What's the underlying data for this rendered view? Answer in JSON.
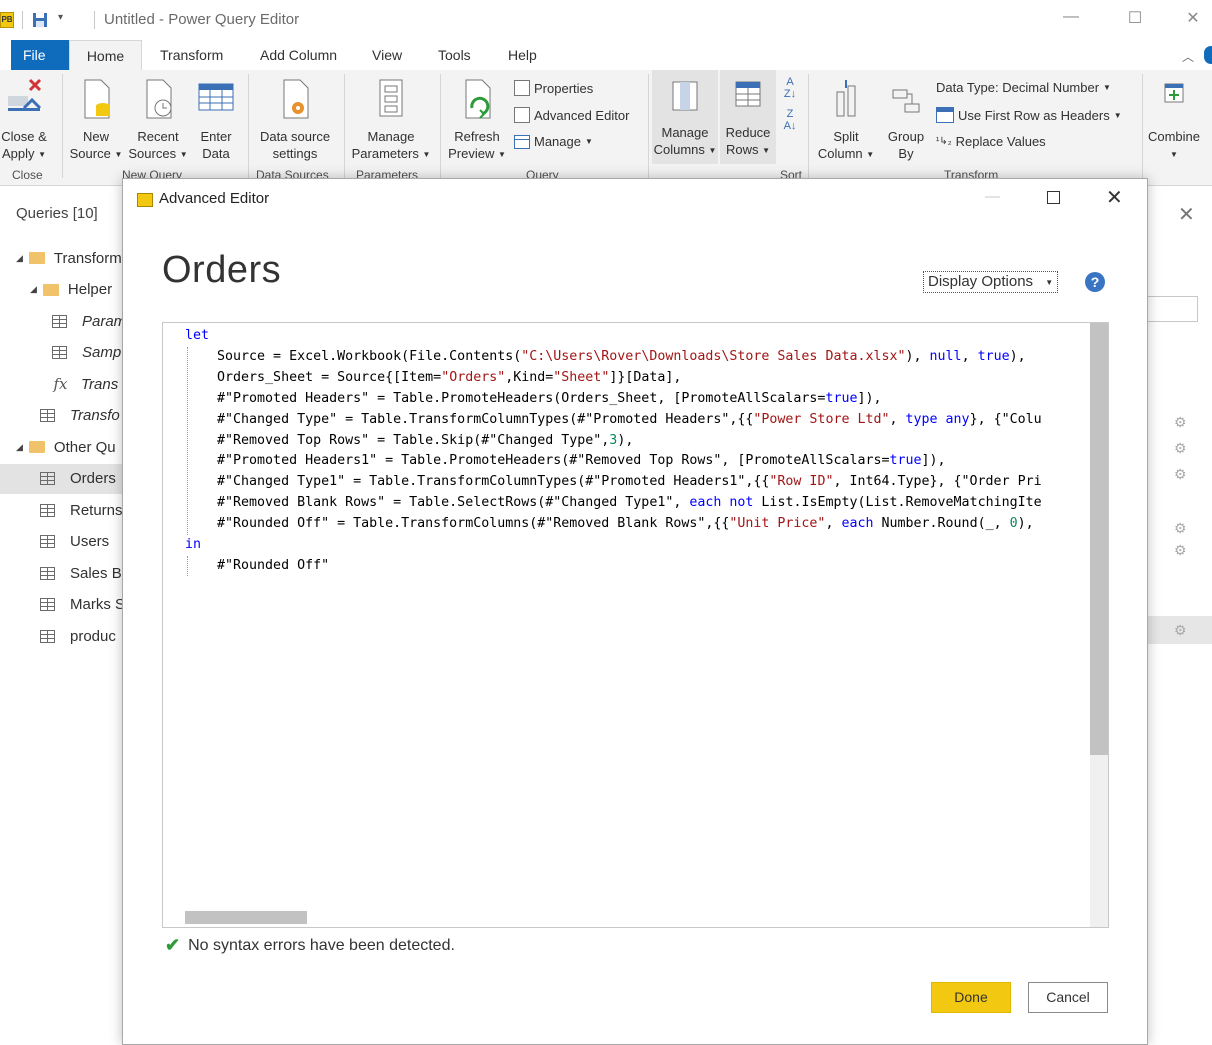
{
  "window": {
    "title": "Untitled - Power Query Editor",
    "app_icon_glyph": "PB",
    "quick_access_dropdown": "▾"
  },
  "tabs": [
    "File",
    "Home",
    "Transform",
    "Add Column",
    "View",
    "Tools",
    "Help"
  ],
  "ribbon": {
    "close_apply": [
      "Close &",
      "Apply"
    ],
    "new_source": [
      "New",
      "Source"
    ],
    "recent_sources": [
      "Recent",
      "Sources"
    ],
    "enter_data": [
      "Enter",
      "Data"
    ],
    "data_source_settings": [
      "Data source",
      "settings"
    ],
    "manage_parameters": [
      "Manage",
      "Parameters"
    ],
    "refresh_preview": [
      "Refresh",
      "Preview"
    ],
    "properties": "Properties",
    "advanced_editor": "Advanced Editor",
    "manage": "Manage",
    "manage_columns": [
      "Manage",
      "Columns"
    ],
    "reduce_rows": [
      "Reduce",
      "Rows"
    ],
    "split_column": [
      "Split",
      "Column"
    ],
    "group_by": [
      "Group",
      "By"
    ],
    "data_type": "Data Type: Decimal Number",
    "use_first_row": "Use First Row as Headers",
    "replace_values": "Replace Values",
    "combine": "Combine",
    "groups": {
      "close": "Close",
      "new_query": "New Query",
      "data_sources": "Data Sources",
      "parameters": "Parameters",
      "query": "Query",
      "sort": "Sort",
      "transform": "Transform"
    }
  },
  "queries": {
    "title": "Queries [10]",
    "items": [
      {
        "label": "Transform",
        "kind": "folder",
        "level": 0
      },
      {
        "label": "Helper",
        "kind": "folder",
        "level": 1
      },
      {
        "label": "Param",
        "kind": "param",
        "level": 2
      },
      {
        "label": "Samp",
        "kind": "sample",
        "level": 2
      },
      {
        "label": "Trans",
        "kind": "function",
        "level": 2
      },
      {
        "label": "Transfo",
        "kind": "table",
        "level": 1
      },
      {
        "label": "Other Qu",
        "kind": "folder",
        "level": 0
      },
      {
        "label": "Orders",
        "kind": "table",
        "level": 1,
        "selected": true
      },
      {
        "label": "Returns",
        "kind": "table",
        "level": 1
      },
      {
        "label": "Users",
        "kind": "table",
        "level": 1
      },
      {
        "label": "Sales B",
        "kind": "table",
        "level": 1
      },
      {
        "label": "Marks S",
        "kind": "table",
        "level": 1
      },
      {
        "label": "produc",
        "kind": "table",
        "level": 1
      }
    ]
  },
  "dialog": {
    "title": "Advanced Editor",
    "query_name": "Orders",
    "display_options": "Display Options",
    "help": "?",
    "syntax_status": "No syntax errors have been detected.",
    "done": "Done",
    "cancel": "Cancel"
  },
  "code_lines": [
    "let",
    "    Source = Excel.Workbook(File.Contents(\"C:\\Users\\Rover\\Downloads\\Store Sales Data.xlsx\"), null, true),",
    "    Orders_Sheet = Source{[Item=\"Orders\",Kind=\"Sheet\"]}[Data],",
    "    #\"Promoted Headers\" = Table.PromoteHeaders(Orders_Sheet, [PromoteAllScalars=true]),",
    "    #\"Changed Type\" = Table.TransformColumnTypes(#\"Promoted Headers\",{{\"Power Store Ltd\", type any}, {\"Colu",
    "    #\"Removed Top Rows\" = Table.Skip(#\"Changed Type\",3),",
    "    #\"Promoted Headers1\" = Table.PromoteHeaders(#\"Removed Top Rows\", [PromoteAllScalars=true]),",
    "    #\"Changed Type1\" = Table.TransformColumnTypes(#\"Promoted Headers1\",{{\"Row ID\", Int64.Type}, {\"Order Pri",
    "    #\"Removed Blank Rows\" = Table.SelectRows(#\"Changed Type1\", each not List.IsEmpty(List.RemoveMatchingIte",
    "    #\"Rounded Off\" = Table.TransformColumns(#\"Removed Blank Rows\",{{\"Unit Price\", each Number.Round(_, 0),",
    "in",
    "    #\"Rounded Off\""
  ],
  "colors": {
    "accent_file_tab": "#0f6cbd",
    "done_button": "#f2c811",
    "keyword": "#0000ff",
    "string": "#a31515",
    "number": "#09885a",
    "success_check": "#2e9b3a"
  }
}
